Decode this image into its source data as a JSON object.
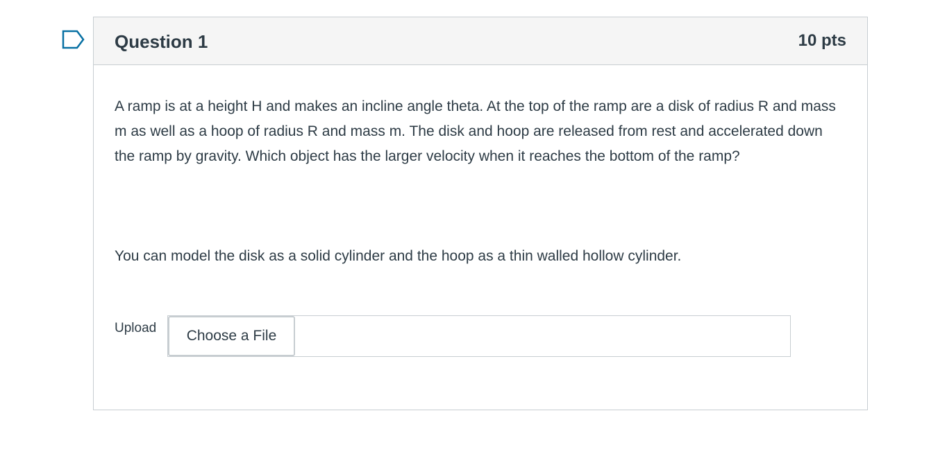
{
  "question": {
    "title": "Question 1",
    "points": "10 pts",
    "text": "A ramp is at a height H and makes an incline angle theta. At the top of the ramp are a disk of radius R and mass m as well as  a hoop of radius R and mass m. The disk and hoop are released from rest and accelerated down the ramp by gravity. Which object has the larger velocity when it reaches the bottom of the ramp?",
    "note": "You can model the disk as a solid cylinder and the hoop as a thin walled hollow cylinder."
  },
  "upload": {
    "label": "Upload",
    "button_label": "Choose a File"
  },
  "icons": {
    "flag": "flag-question-icon"
  },
  "colors": {
    "text": "#2d3b45",
    "border": "#c7cdd1",
    "header_bg": "#f5f5f5",
    "flag": "#0770a3"
  }
}
